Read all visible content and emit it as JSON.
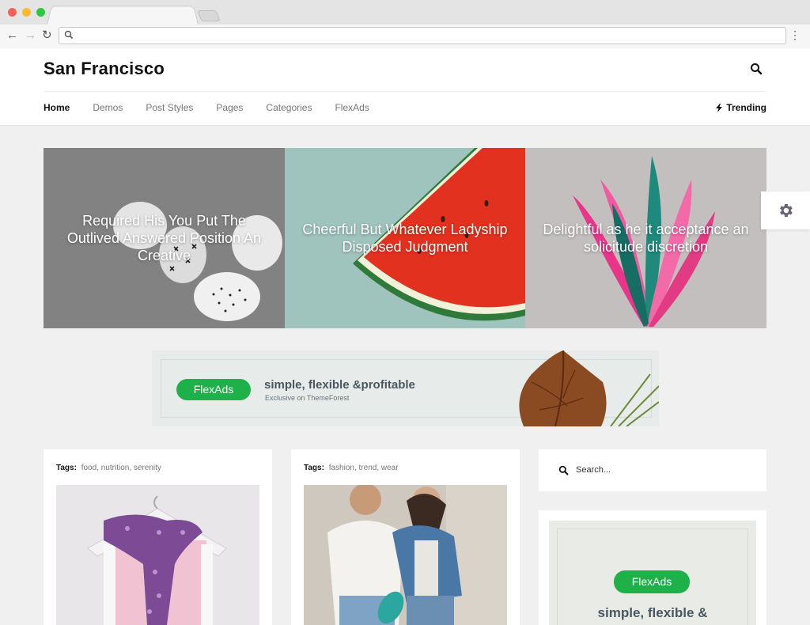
{
  "browser": {
    "nav": {
      "back_icon": "back-arrow-icon",
      "forward_icon": "forward-arrow-icon",
      "reload_icon": "reload-icon",
      "menu_icon": "kebab-menu-icon"
    },
    "url": ""
  },
  "header": {
    "logo": "San Francisco",
    "menu": [
      "Home",
      "Demos",
      "Post Styles",
      "Pages",
      "Categories",
      "FlexAds"
    ],
    "active_menu": "Home",
    "trending": "Trending"
  },
  "hero": {
    "slides": [
      {
        "title": "Required His You Put The Outlived Answered Position An Creative"
      },
      {
        "title": "Cheerful But Whatever Ladyship Disposed Judgment"
      },
      {
        "title": "Delightful as he it acceptance an solicitude discretion"
      }
    ]
  },
  "ad_banner": {
    "pill": "FlexAds",
    "headline": "simple, flexible &profitable",
    "subline": "Exclusive on ThemeForest"
  },
  "cards": [
    {
      "tags_label": "Tags:",
      "tags": [
        "food",
        "nutrition",
        "serenity"
      ]
    },
    {
      "tags_label": "Tags:",
      "tags": [
        "fashion",
        "trend",
        "wear"
      ]
    }
  ],
  "sidebar": {
    "search_placeholder": "Search...",
    "ad": {
      "pill": "FlexAds",
      "headline": "simple, flexible &"
    }
  },
  "colors": {
    "accent_green": "#1eb14a",
    "text_dark": "#111111",
    "page_bg": "#f0f0f0"
  }
}
